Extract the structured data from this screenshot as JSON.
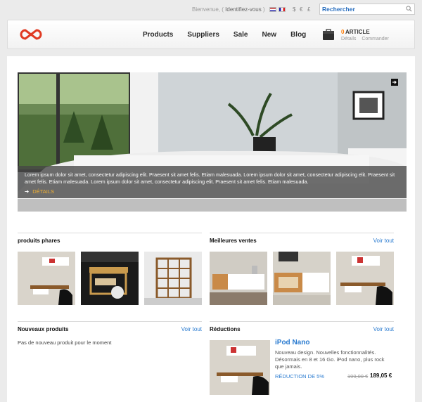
{
  "topbar": {
    "welcome_prefix": "Bienvenue, (",
    "login_link": "Identifiez-vous",
    "welcome_suffix": ")",
    "currencies": [
      "$",
      "€",
      "£"
    ],
    "search_placeholder": "Rechercher"
  },
  "nav": {
    "items": [
      "Products",
      "Suppliers",
      "Sale",
      "New",
      "Blog"
    ]
  },
  "cart": {
    "count": "0",
    "label": "ARTICLE",
    "details": "Détails",
    "checkout": "Commander"
  },
  "hero": {
    "caption": "Lorem ipsum dolor sit amet, consectetur adipiscing elit. Praesent sit amet felis. Etiam malesuada. Lorem ipsum dolor sit amet, consectetur adipiscing elit. Praesent sit amet felis. Etiam malesuada. Lorem ipsum dolor sit amet, consectetur adipiscing elit. Praesent sit amet felis. Etiam malesuada.",
    "link": "DÉTAILS"
  },
  "featured": {
    "title": "produits phares"
  },
  "bestsellers": {
    "title": "Meilleures ventes",
    "link": "Voir tout"
  },
  "new_products": {
    "title": "Nouveaux produits",
    "link": "Voir tout",
    "empty": "Pas de nouveau produit pour le moment"
  },
  "specials": {
    "title": "Réductions",
    "link": "Voir tout",
    "product": {
      "name": "iPod Nano",
      "description": "Nouveau design. Nouvelles fonctionnalités. Désormais en 8 et 16 Go. iPod nano, plus rock que jamais.",
      "discount": "RÉDUCTION DE 5%",
      "old_price": "199,00 €",
      "price": "189,05 €"
    }
  },
  "colors": {
    "accent": "#2a7bd0",
    "cart_count": "#ff7a00",
    "hero_link": "#f3b233"
  }
}
